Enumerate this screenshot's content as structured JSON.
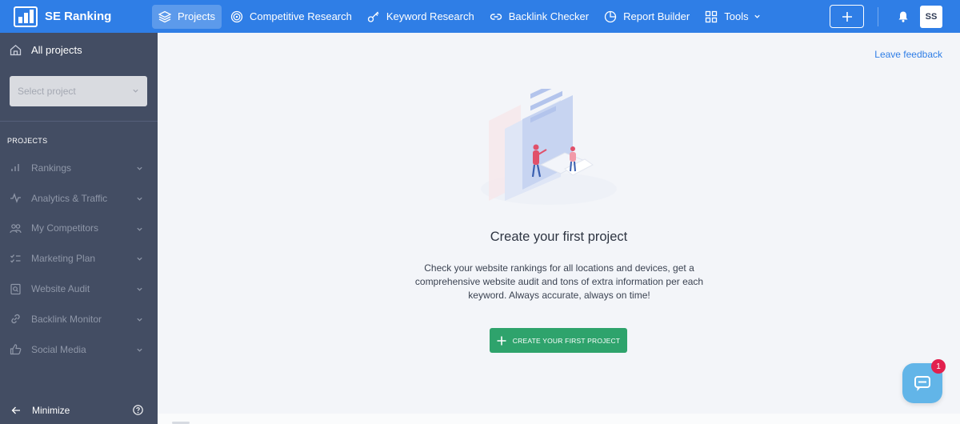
{
  "brand": {
    "name": "SE Ranking"
  },
  "topnav": {
    "items": [
      {
        "label": "Projects",
        "icon": "layers-icon",
        "active": true
      },
      {
        "label": "Competitive Research",
        "icon": "target-icon"
      },
      {
        "label": "Keyword Research",
        "icon": "key-icon"
      },
      {
        "label": "Backlink Checker",
        "icon": "link-icon"
      },
      {
        "label": "Report Builder",
        "icon": "pie-icon"
      },
      {
        "label": "Tools",
        "icon": "grid-icon"
      }
    ],
    "avatar_initials": "SS"
  },
  "sidebar": {
    "all_projects": "All projects",
    "select_placeholder": "Select project",
    "section_heading": "PROJECTS",
    "items": [
      {
        "label": "Rankings",
        "icon": "bar-chart-icon"
      },
      {
        "label": "Analytics & Traffic",
        "icon": "pulse-icon"
      },
      {
        "label": "My Competitors",
        "icon": "users-icon"
      },
      {
        "label": "Marketing Plan",
        "icon": "checklist-icon"
      },
      {
        "label": "Website Audit",
        "icon": "audit-icon"
      },
      {
        "label": "Backlink Monitor",
        "icon": "link-icon"
      },
      {
        "label": "Social Media",
        "icon": "thumbs-up-icon"
      }
    ],
    "minimize": "Minimize"
  },
  "main": {
    "feedback_link": "Leave feedback",
    "title": "Create your first project",
    "description": "Check your website rankings for all locations and devices, get a comprehensive website audit and tons of extra information per each keyword. Always accurate, always on time!",
    "cta": "CREATE YOUR FIRST PROJECT"
  },
  "chat": {
    "badge": "1"
  },
  "colors": {
    "topbar": "#2f7ee6",
    "sidebar": "#434d63",
    "cta": "#2ea36c",
    "badge": "#e2204e"
  }
}
